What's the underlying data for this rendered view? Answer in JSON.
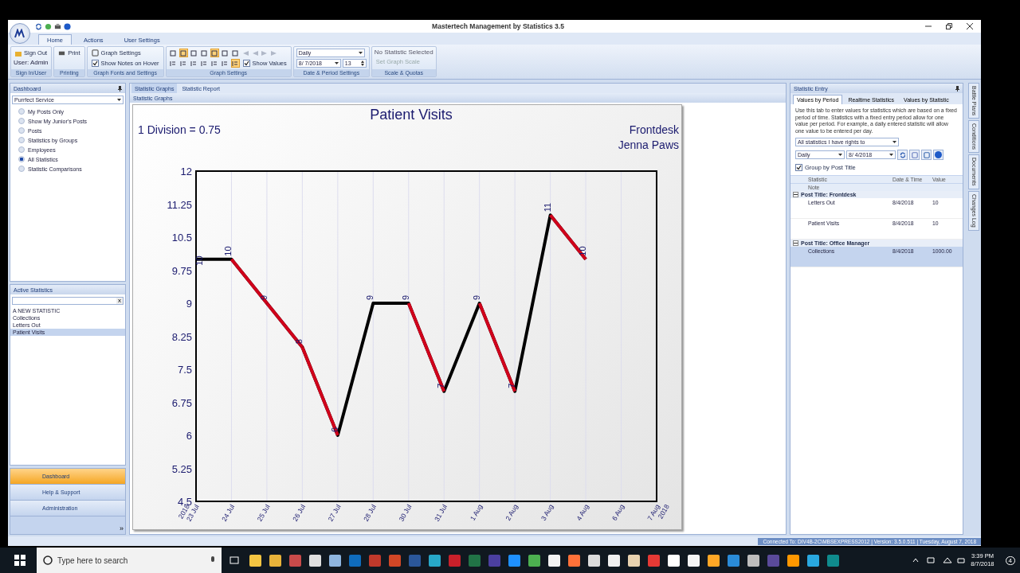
{
  "window": {
    "title": "Mastertech Management by Statistics 3.5"
  },
  "ribbon": {
    "tabs": [
      {
        "label": "Home",
        "selected": true
      },
      {
        "label": "Actions",
        "selected": false
      },
      {
        "label": "User Settings",
        "selected": false
      }
    ],
    "sign_in": {
      "sign_out": "Sign Out",
      "user": "User: Admin",
      "group": "Sign In/User"
    },
    "printing": {
      "print": "Print",
      "group": "Printing"
    },
    "graph_fonts": {
      "graph_settings": "Graph Settings",
      "show_notes": {
        "label": "Show Notes on Hover",
        "checked": true
      },
      "group": "Graph Fonts and Settings"
    },
    "graph_settings": {
      "row_1": [
        {
          "selected": false
        },
        {
          "selected": true
        },
        {
          "selected": false
        },
        {
          "selected": false
        },
        {
          "selected": true
        },
        {
          "selected": false
        },
        {
          "selected": false
        }
      ],
      "row_2": [
        {
          "selected": false
        },
        {
          "selected": false
        },
        {
          "selected": false
        },
        {
          "selected": false
        },
        {
          "selected": false
        },
        {
          "selected": false
        },
        {
          "selected": true
        }
      ],
      "show_values": {
        "label": "Show Values",
        "checked": true
      },
      "group": "Graph Settings"
    },
    "date_period": {
      "period": "Daily",
      "date": "8/ 7/2018",
      "count": "13",
      "group": "Date & Period Settings"
    },
    "scale": {
      "status": "No Statistic Selected",
      "set_scale": {
        "label": "Set Graph Scale",
        "disabled": true
      },
      "group": "Scale & Quotas"
    }
  },
  "dashboard": {
    "title": "Dashboard",
    "dropdown": "Purrfect Service",
    "options": [
      {
        "label": "My Posts Only",
        "selected": false
      },
      {
        "label": "Show My Junior's Posts",
        "selected": false
      },
      {
        "label": "Posts",
        "selected": false
      },
      {
        "label": "Statistics by Groups",
        "selected": false
      },
      {
        "label": "Employees",
        "selected": false
      },
      {
        "label": "All Statistics",
        "selected": true
      },
      {
        "label": "Statistic Comparisons",
        "selected": false
      }
    ]
  },
  "active_statistics": {
    "title": "Active Statistics",
    "clear": "x",
    "items": [
      {
        "label": "A NEW STATISTIC",
        "selected": false
      },
      {
        "label": "Collections",
        "selected": false
      },
      {
        "label": "Letters Out",
        "selected": false
      },
      {
        "label": "Patient Visits",
        "selected": true
      }
    ]
  },
  "navigation": [
    {
      "label": "Dashboard",
      "selected": true
    },
    {
      "label": "Help & Support",
      "selected": false
    },
    {
      "label": "Administration",
      "selected": false
    }
  ],
  "nav_more": "»",
  "center": {
    "tabs": [
      {
        "label": "Statistic Graphs",
        "selected": true
      },
      {
        "label": "Statistic Report",
        "selected": false
      }
    ],
    "header": "Statistic Graphs",
    "chart": {
      "division": "1 Division = 0.75",
      "post": "Frontdesk",
      "owner": "Jenna Paws",
      "start_year": "2018",
      "end_year": "2018",
      "chart_data": {
        "type": "line",
        "title": "Patient Visits",
        "categories": [
          "23 Jul",
          "24 Jul",
          "25 Jul",
          "26 Jul",
          "27 Jul",
          "28 Jul",
          "30 Jul",
          "31 Jul",
          "1 Aug",
          "2 Aug",
          "3 Aug",
          "4 Aug",
          "6 Aug",
          "7 Aug"
        ],
        "series": [
          {
            "color": "#000000",
            "values": [
              10,
              10,
              9,
              8,
              6,
              9,
              9,
              7,
              9,
              7,
              11,
              10,
              null,
              null
            ]
          }
        ],
        "grid": true,
        "ylim": [
          4.5,
          12
        ],
        "yticks": [
          4.5,
          5.25,
          6,
          6.75,
          7.5,
          8.25,
          9,
          9.75,
          10.5,
          11.25,
          12
        ],
        "data_labels": true
      }
    }
  },
  "statistic_entry": {
    "title": "Statistic Entry",
    "tabs": [
      {
        "label": "Values by Period",
        "selected": true
      },
      {
        "label": "Realtime Statistics",
        "selected": false
      },
      {
        "label": "Values by Statistic",
        "selected": false
      }
    ],
    "description": "Use this tab to enter values for statistics which are based on a fixed period of time. Statistics with a fixed entry period allow for one value per period. For example, a daily entered statistic will allow one value to be entered per day.",
    "filter": "All statistics I have rights to",
    "period": "Daily",
    "date": "8/ 4/2018",
    "group_by": {
      "label": "Group by Post Title",
      "checked": true
    },
    "columns": [
      "Statistic",
      "Date & Time",
      "Value"
    ],
    "note_column": "Note",
    "groups": [
      {
        "title": "Post Title:  Frontdesk",
        "expanded": true,
        "rows": [
          {
            "statistic": "Letters Out",
            "date": "8/4/2018",
            "value": "10",
            "selected": false
          },
          {
            "statistic": "Patient Visits",
            "date": "8/4/2018",
            "value": "10",
            "selected": false
          }
        ]
      },
      {
        "title": "Post Title:  Office Manager",
        "expanded": true,
        "rows": [
          {
            "statistic": "Collections",
            "date": "8/4/2018",
            "value": "1000.00",
            "selected": true
          }
        ]
      }
    ]
  },
  "side_tabs": [
    "Battle Plans",
    "Conditions",
    "Documents",
    "Changes Log"
  ],
  "status_bar": "Connected To: DIV4B-2C\\MBSEXPRESS2012 | Version: 3.5.0.511 | Tuesday, August 7, 2018",
  "taskbar": {
    "search": "Type here to search",
    "apps": [
      {
        "color": "#f4c542"
      },
      {
        "color": "#e8b33a"
      },
      {
        "color": "#c84a4a"
      },
      {
        "color": "#e0e0e0"
      },
      {
        "color": "#8fb6e0"
      },
      {
        "color": "#0f6cbd"
      },
      {
        "color": "#c0392b"
      },
      {
        "color": "#d24726"
      },
      {
        "color": "#2b579a"
      },
      {
        "color": "#27a8c8"
      },
      {
        "color": "#c8202a"
      },
      {
        "color": "#217346"
      },
      {
        "color": "#4b3fa0"
      },
      {
        "color": "#1e90ff"
      },
      {
        "color": "#4caf50"
      },
      {
        "color": "#f2f2f2"
      },
      {
        "color": "#ff7139"
      },
      {
        "color": "#dcdcdc"
      },
      {
        "color": "#f0f0f0"
      },
      {
        "color": "#e8d2b0"
      },
      {
        "color": "#e53935"
      },
      {
        "color": "#ffffff"
      },
      {
        "color": "#f5f5f5"
      },
      {
        "color": "#ffa726"
      },
      {
        "color": "#2a8bd8"
      },
      {
        "color": "#bdbdbd"
      },
      {
        "color": "#5a4a9a"
      },
      {
        "color": "#ff9800"
      },
      {
        "color": "#29a8e0"
      },
      {
        "color": "#0f8b8d"
      }
    ],
    "time": "3:39 PM",
    "date": "8/7/2018",
    "notifications": "4"
  }
}
